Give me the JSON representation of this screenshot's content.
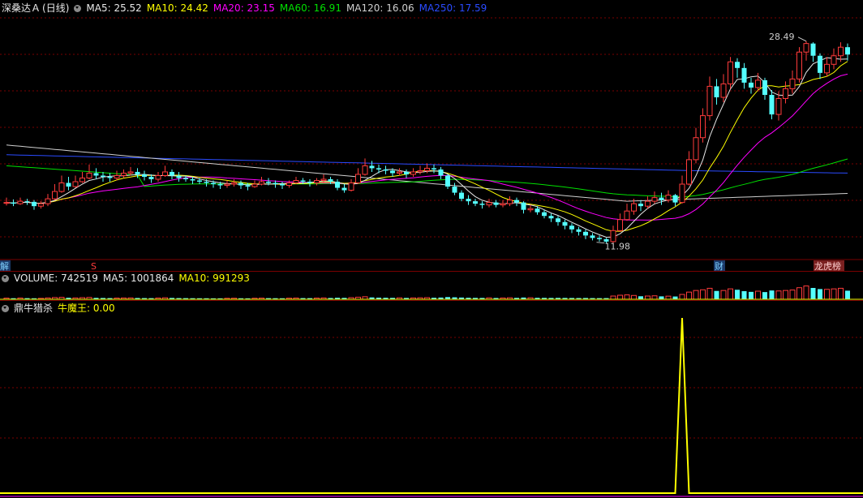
{
  "header": {
    "stock_name": "深桑达Ａ",
    "period": "(日线)",
    "ma_items": [
      {
        "label": "MA5: 25.52",
        "color": "#e8e8e8"
      },
      {
        "label": "MA10: 24.42",
        "color": "#ffff00"
      },
      {
        "label": "MA20: 23.15",
        "color": "#ff00ff"
      },
      {
        "label": "MA60: 16.91",
        "color": "#00e000"
      },
      {
        "label": "MA120: 16.06",
        "color": "#cfcfcf"
      },
      {
        "label": "MA250: 17.59",
        "color": "#2a4bff"
      }
    ]
  },
  "volume_header": {
    "label": "VOLUME: 742519",
    "ma5": "MA5: 1001864",
    "ma10": "MA10: 991293"
  },
  "indicator_header": {
    "name": "鼎牛猎杀",
    "label": "牛魔王: 0.00"
  },
  "markers": {
    "left_edge": "解",
    "s_marker": "S",
    "cai": "财",
    "longhu": "龙虎榜"
  },
  "chart_data": {
    "type": "candlestick",
    "price_range": [
      10.5,
      30.4
    ],
    "annotations": [
      {
        "text": "28.49",
        "note": "high"
      },
      {
        "text": "11.98",
        "note": "low"
      }
    ],
    "candles": [
      [
        15.23,
        15.3,
        15.7,
        15.05
      ],
      [
        15.3,
        15.2,
        15.55,
        15.0
      ],
      [
        15.2,
        15.4,
        15.7,
        15.1
      ],
      [
        15.4,
        15.35,
        15.6,
        15.1
      ],
      [
        15.35,
        15.0,
        15.5,
        14.7
      ],
      [
        15.0,
        15.2,
        15.4,
        14.8
      ],
      [
        15.2,
        15.6,
        16.0,
        15.0
      ],
      [
        15.6,
        16.2,
        16.8,
        15.5
      ],
      [
        16.2,
        16.9,
        17.5,
        16.1
      ],
      [
        16.9,
        16.6,
        17.4,
        16.3
      ],
      [
        16.6,
        17.0,
        17.5,
        16.5
      ],
      [
        17.0,
        17.3,
        17.8,
        16.9
      ],
      [
        17.3,
        17.7,
        18.4,
        17.2
      ],
      [
        17.7,
        17.5,
        18.1,
        17.2
      ],
      [
        17.5,
        17.4,
        17.8,
        17.0
      ],
      [
        17.4,
        17.3,
        17.7,
        17.0
      ],
      [
        17.3,
        17.5,
        17.9,
        17.1
      ],
      [
        17.5,
        17.7,
        18.0,
        17.3
      ],
      [
        17.7,
        17.8,
        18.2,
        17.5
      ],
      [
        17.8,
        17.6,
        18.1,
        17.3
      ],
      [
        17.6,
        17.4,
        17.9,
        17.1
      ],
      [
        17.4,
        17.2,
        17.6,
        16.9
      ],
      [
        17.2,
        17.5,
        17.8,
        17.0
      ],
      [
        17.5,
        17.8,
        18.3,
        17.4
      ],
      [
        17.8,
        17.5,
        18.0,
        17.2
      ],
      [
        17.5,
        17.3,
        17.8,
        17.0
      ],
      [
        17.3,
        17.2,
        17.5,
        17.0
      ],
      [
        17.2,
        17.1,
        17.4,
        16.8
      ],
      [
        17.1,
        17.0,
        17.3,
        16.8
      ],
      [
        17.0,
        16.9,
        17.2,
        16.6
      ],
      [
        16.9,
        16.8,
        17.1,
        16.5
      ],
      [
        16.8,
        16.7,
        17.0,
        16.4
      ],
      [
        16.7,
        16.8,
        17.1,
        16.5
      ],
      [
        16.8,
        16.9,
        17.2,
        16.6
      ],
      [
        16.9,
        16.7,
        17.1,
        16.4
      ],
      [
        16.7,
        16.6,
        16.9,
        16.3
      ],
      [
        16.6,
        16.8,
        17.1,
        16.5
      ],
      [
        16.8,
        17.0,
        17.4,
        16.7
      ],
      [
        17.0,
        16.9,
        17.3,
        16.7
      ],
      [
        16.9,
        16.8,
        17.1,
        16.5
      ],
      [
        16.8,
        16.7,
        17.0,
        16.4
      ],
      [
        16.7,
        16.9,
        17.1,
        16.5
      ],
      [
        16.9,
        17.1,
        17.4,
        16.8
      ],
      [
        17.1,
        17.0,
        17.3,
        16.8
      ],
      [
        17.0,
        16.9,
        17.2,
        16.6
      ],
      [
        16.9,
        17.1,
        17.3,
        16.7
      ],
      [
        17.1,
        17.2,
        17.6,
        16.9
      ],
      [
        17.2,
        17.0,
        17.4,
        16.8
      ],
      [
        17.0,
        16.5,
        17.2,
        16.3
      ],
      [
        16.5,
        16.3,
        16.8,
        16.1
      ],
      [
        16.3,
        16.9,
        17.2,
        16.2
      ],
      [
        16.9,
        17.6,
        18.1,
        16.8
      ],
      [
        17.6,
        18.3,
        18.9,
        17.5
      ],
      [
        18.3,
        18.1,
        18.7,
        17.8
      ],
      [
        18.1,
        18.0,
        18.4,
        17.7
      ],
      [
        18.0,
        17.9,
        18.3,
        17.6
      ],
      [
        17.9,
        17.7,
        18.1,
        17.4
      ],
      [
        17.7,
        17.8,
        18.1,
        17.5
      ],
      [
        17.8,
        17.6,
        18.0,
        17.3
      ],
      [
        17.6,
        17.8,
        18.1,
        17.4
      ],
      [
        17.8,
        17.9,
        18.3,
        17.6
      ],
      [
        17.9,
        18.1,
        18.5,
        17.7
      ],
      [
        18.1,
        18.0,
        18.4,
        17.7
      ],
      [
        18.0,
        17.5,
        18.2,
        17.2
      ],
      [
        17.5,
        16.6,
        17.6,
        16.4
      ],
      [
        16.6,
        16.1,
        16.9,
        15.9
      ],
      [
        16.1,
        15.6,
        16.3,
        15.4
      ],
      [
        15.6,
        15.4,
        15.9,
        15.1
      ],
      [
        15.4,
        15.2,
        15.6,
        15.0
      ],
      [
        15.2,
        15.1,
        15.4,
        14.8
      ],
      [
        15.1,
        15.3,
        15.6,
        14.9
      ],
      [
        15.3,
        15.1,
        15.5,
        14.9
      ],
      [
        15.1,
        15.2,
        15.5,
        14.9
      ],
      [
        15.2,
        15.5,
        15.8,
        15.0
      ],
      [
        15.5,
        15.3,
        15.7,
        15.0
      ],
      [
        15.3,
        14.7,
        15.4,
        14.4
      ],
      [
        14.7,
        14.8,
        15.1,
        14.5
      ],
      [
        14.8,
        14.5,
        15.0,
        14.3
      ],
      [
        14.5,
        14.2,
        14.7,
        14.0
      ],
      [
        14.2,
        14.0,
        14.4,
        13.7
      ],
      [
        14.0,
        13.7,
        14.2,
        13.4
      ],
      [
        13.7,
        13.4,
        13.9,
        13.1
      ],
      [
        13.4,
        13.1,
        13.6,
        12.8
      ],
      [
        13.1,
        12.9,
        13.3,
        12.6
      ],
      [
        12.9,
        12.6,
        13.1,
        12.3
      ],
      [
        12.6,
        12.4,
        12.8,
        12.2
      ],
      [
        12.4,
        12.3,
        12.6,
        12.1
      ],
      [
        12.3,
        12.1,
        12.4,
        11.98
      ],
      [
        12.1,
        13.0,
        13.4,
        12.0
      ],
      [
        13.0,
        13.9,
        14.4,
        12.9
      ],
      [
        13.9,
        14.6,
        15.2,
        13.8
      ],
      [
        14.6,
        15.2,
        15.6,
        14.3
      ],
      [
        15.2,
        15.0,
        15.5,
        14.6
      ],
      [
        15.0,
        15.4,
        15.8,
        14.8
      ],
      [
        15.4,
        15.7,
        16.2,
        15.2
      ],
      [
        15.7,
        15.5,
        16.1,
        15.1
      ],
      [
        15.5,
        15.9,
        16.3,
        15.3
      ],
      [
        15.9,
        15.3,
        16.0,
        15.0
      ],
      [
        15.3,
        16.8,
        17.5,
        15.2
      ],
      [
        16.8,
        18.8,
        19.5,
        16.7
      ],
      [
        18.8,
        20.6,
        21.4,
        18.5
      ],
      [
        20.6,
        22.4,
        23.0,
        20.2
      ],
      [
        22.4,
        24.8,
        25.6,
        22.0
      ],
      [
        24.8,
        23.9,
        25.4,
        23.3
      ],
      [
        23.9,
        25.0,
        25.8,
        23.5
      ],
      [
        25.0,
        26.8,
        27.2,
        24.6
      ],
      [
        26.8,
        26.3,
        27.1,
        25.5
      ],
      [
        26.3,
        25.1,
        26.7,
        24.6
      ],
      [
        25.1,
        24.7,
        25.5,
        24.2
      ],
      [
        24.7,
        25.3,
        25.9,
        24.4
      ],
      [
        25.3,
        24.1,
        25.5,
        23.7
      ],
      [
        24.1,
        22.5,
        24.5,
        22.1
      ],
      [
        22.5,
        23.8,
        24.4,
        22.0
      ],
      [
        23.8,
        24.6,
        25.2,
        23.4
      ],
      [
        24.6,
        25.4,
        26.1,
        24.2
      ],
      [
        25.4,
        27.6,
        28.0,
        25.1
      ],
      [
        27.6,
        28.3,
        28.49,
        26.9
      ],
      [
        28.3,
        27.3,
        28.4,
        26.8
      ],
      [
        27.3,
        25.9,
        27.5,
        25.4
      ],
      [
        25.9,
        26.6,
        27.2,
        25.6
      ],
      [
        26.6,
        27.3,
        27.9,
        26.2
      ],
      [
        27.3,
        28.0,
        28.4,
        26.8
      ],
      [
        28.0,
        27.4,
        28.3,
        26.9
      ]
    ],
    "volume_range": [
      0,
      1400000
    ],
    "volumes": [
      100000,
      90000,
      110000,
      95000,
      85000,
      80000,
      120000,
      150000,
      170000,
      130000,
      120000,
      140000,
      160000,
      120000,
      110000,
      100000,
      105000,
      115000,
      120000,
      110000,
      100000,
      95000,
      110000,
      130000,
      115000,
      100000,
      95000,
      90000,
      85000,
      85000,
      80000,
      80000,
      85000,
      90000,
      85000,
      80000,
      90000,
      100000,
      95000,
      90000,
      85000,
      95000,
      110000,
      100000,
      95000,
      105000,
      120000,
      110000,
      130000,
      120000,
      140000,
      180000,
      220000,
      160000,
      140000,
      130000,
      120000,
      125000,
      115000,
      120000,
      130000,
      140000,
      130000,
      150000,
      190000,
      170000,
      150000,
      130000,
      120000,
      115000,
      125000,
      110000,
      115000,
      130000,
      120000,
      150000,
      130000,
      125000,
      120000,
      115000,
      120000,
      115000,
      110000,
      105000,
      110000,
      100000,
      95000,
      100000,
      280000,
      350000,
      380000,
      330000,
      260000,
      280000,
      300000,
      250000,
      270000,
      240000,
      420000,
      620000,
      760000,
      820000,
      950000,
      720000,
      760000,
      900000,
      820000,
      700000,
      640000,
      700000,
      620000,
      760000,
      720000,
      760000,
      800000,
      1000000,
      1150000,
      980000,
      880000,
      860000,
      900000,
      950000,
      742519
    ],
    "indicator_range": [
      0,
      1.0
    ],
    "indicator_name": "牛魔王",
    "indicator_spike_index": 98,
    "indicator_spike_value": 1.0
  }
}
